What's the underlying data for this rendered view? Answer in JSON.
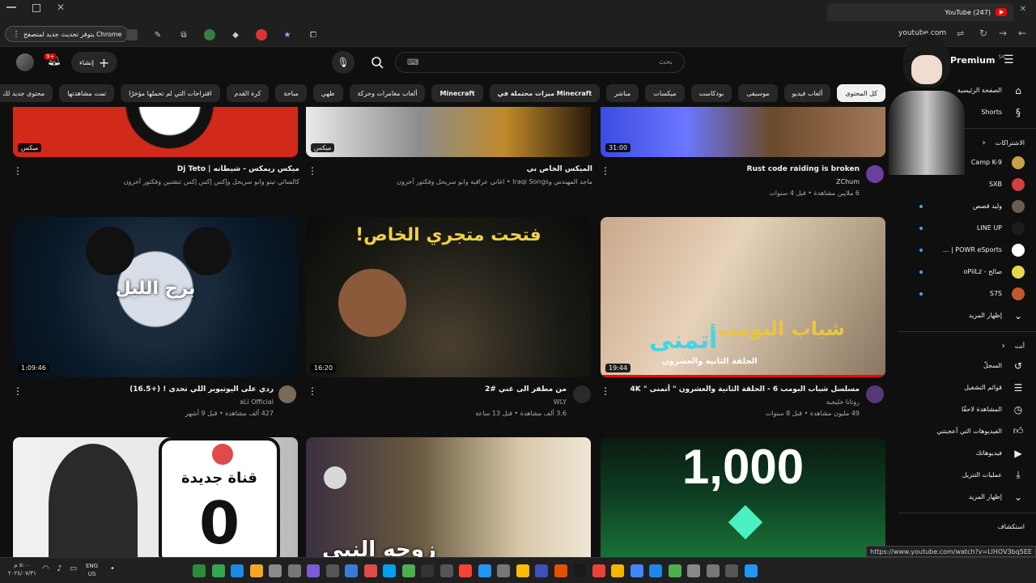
{
  "browser": {
    "tab_title": "(247) YouTube",
    "update_button": "يتوفر تحديث جديد لمتصفح Chrome",
    "url": "youtube.com",
    "status_url": "https://www.youtube.com/watch?v=LlHOV3bq5EE"
  },
  "header": {
    "logo": "Premium",
    "logo_region": "SA",
    "search_placeholder": "بحث",
    "create_label": "إنشاء",
    "notification_count": "9+"
  },
  "chips": [
    {
      "label": "كل المحتوى",
      "active": true
    },
    {
      "label": "ألعاب فيديو"
    },
    {
      "label": "موسيقى"
    },
    {
      "label": "بودكاست"
    },
    {
      "label": "ميكسات"
    },
    {
      "label": "مباشر"
    },
    {
      "label": "ميزات محتملة في Minecraft"
    },
    {
      "label": "Minecraft"
    },
    {
      "label": "ألعاب مغامرات وحركة"
    },
    {
      "label": "طهي"
    },
    {
      "label": "مباحة"
    },
    {
      "label": "كرة القدم"
    },
    {
      "label": "اقتراحات التي لم تحملها مؤخرًا"
    },
    {
      "label": "تمت مشاهدتها"
    },
    {
      "label": "محتوى جديد لك"
    }
  ],
  "sidebar": {
    "home": "الصفحة الرئيسية",
    "shorts": "Shorts",
    "subscriptions_title": "الاشتراكات",
    "subs": [
      {
        "name": "Camp K-9",
        "color": "#c9a14a",
        "dot": false
      },
      {
        "name": "SXB",
        "color": "#d43f3f",
        "dot": false
      },
      {
        "name": "وليد قصص",
        "color": "#6a5d4d",
        "dot": true
      },
      {
        "name": "LINE UP",
        "color": "#1d1d1d",
        "dot": true
      },
      {
        "name": "POWR eSports | ...",
        "color": "#ffffff",
        "dot": true
      },
      {
        "name": "صالح - oPiiLz",
        "color": "#e3d84a",
        "dot": true
      },
      {
        "name": "S7S",
        "color": "#c05a2a",
        "dot": true
      }
    ],
    "show_more": "إظهار المزيد",
    "you_title": "أنت",
    "you_items": [
      {
        "label": "السجلّ",
        "icon": "history-icon"
      },
      {
        "label": "قوائم التشغيل",
        "icon": "playlist-icon"
      },
      {
        "label": "المشاهدة لاحقًا",
        "icon": "clock-icon"
      },
      {
        "label": "الفيديوهات التي أعجبتني",
        "icon": "like-icon"
      },
      {
        "label": "فيديوهاتك",
        "icon": "video-icon"
      },
      {
        "label": "عمليات التنزيل",
        "icon": "download-icon"
      },
      {
        "label": "إظهار المزيد",
        "icon": "chevron-down-icon"
      }
    ],
    "explore_title": "استكشاف"
  },
  "videos": [
    {
      "title": "Rust code raiding is broken",
      "channel": "ZChum",
      "meta": "6 ملايين مشاهدة • قبل 4 سنوات",
      "duration": "31:00"
    },
    {
      "title": "الميكس الخاص بي",
      "channel": "ماجد المهندس وIraqi Songs • اغاني عراقية وابو سريحل وفكتور آخرون",
      "meta": "",
      "duration": "ميكس"
    },
    {
      "title": "ميكس ريمكس - شيطانه | Dj Teto",
      "channel": "كالسائي تيتو وابو سريحل وإكس إكس إكس تنشنين وفكتور آخرون",
      "meta": "",
      "duration": "ميكس"
    },
    {
      "title": "مسلسل شباب البومب 6 - الحلقة الثانية والعشرون \" أتمنى \" 4K",
      "channel": "روتانا خليجية",
      "meta": "49 مليون مشاهدة • قبل 8 سنوات",
      "duration": "19:44"
    },
    {
      "title": "من مطفر الى غني #2",
      "channel": "WLY",
      "meta": "3.6 ألف مشاهدة • قبل 13 ساعة",
      "duration": "16:20"
    },
    {
      "title": "ردي على اليوتيوبر اللي تحدى ! (+16.5)",
      "channel": "aLi Official",
      "meta": "427 ألف مشاهدة • قبل 9 أشهر",
      "duration": "1:09:46"
    }
  ],
  "thumb_text": {
    "t4": "برج الليل",
    "t5": "فتحت متجري الخاص!",
    "t6a": "شباب البومب",
    "t6b": "أتمنى",
    "t6c": "الحلقة الثانية والعشرون",
    "t7a": "قناة جديدة",
    "t7b": "0",
    "t8": "زوجه النبي",
    "t9": "1,000"
  },
  "taskbar": {
    "lang": "ENG",
    "region": "US",
    "clock_time": "٥:٠٠ م",
    "clock_date": "٢٠٢٤/٠٧/٣١"
  }
}
